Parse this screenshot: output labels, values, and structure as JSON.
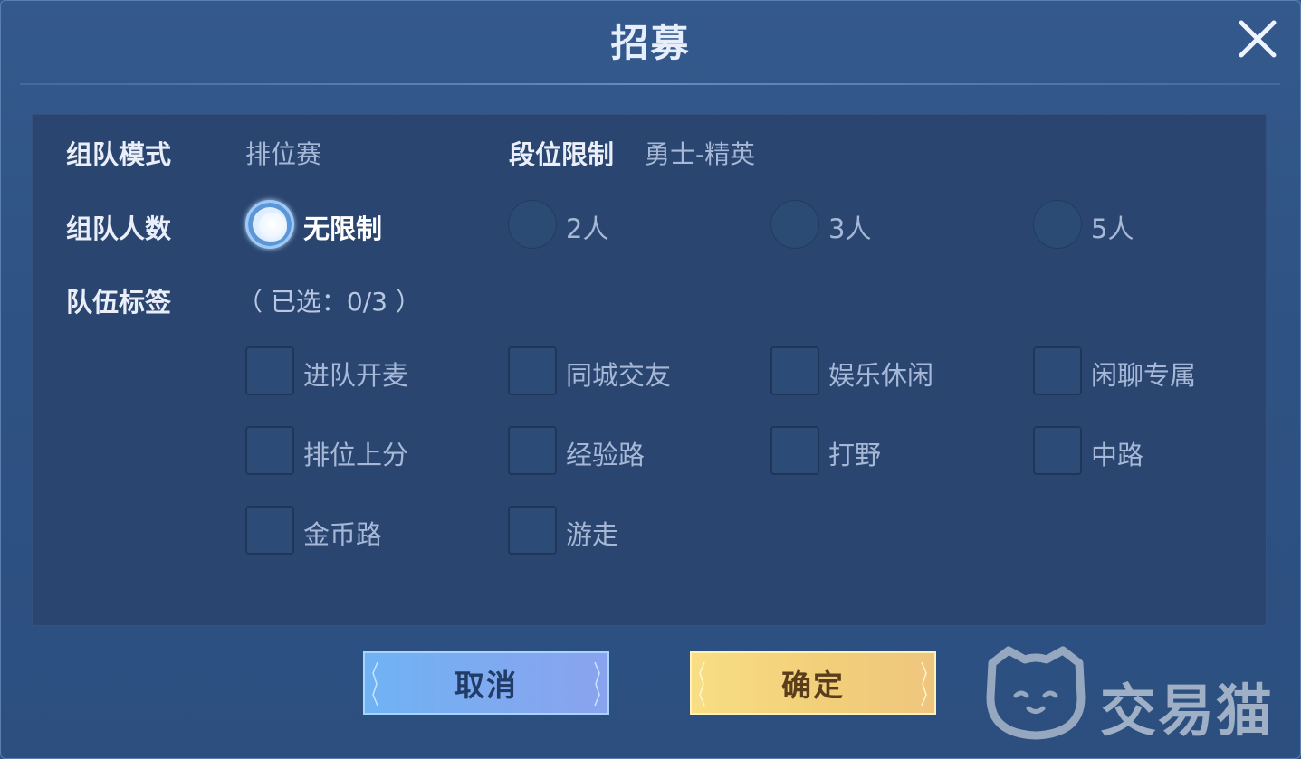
{
  "dialog": {
    "title": "招募"
  },
  "form": {
    "mode": {
      "label": "组队模式",
      "value": "排位赛"
    },
    "rank_limit": {
      "label": "段位限制",
      "value": "勇士-精英"
    },
    "team_size": {
      "label": "组队人数",
      "options": [
        {
          "label": "无限制",
          "selected": true
        },
        {
          "label": "2人",
          "selected": false
        },
        {
          "label": "3人",
          "selected": false
        },
        {
          "label": "5人",
          "selected": false
        }
      ]
    },
    "tags": {
      "label": "队伍标签",
      "selected_count_text": "（ 已选：0/3 ）",
      "items": [
        {
          "label": "进队开麦",
          "checked": false
        },
        {
          "label": "同城交友",
          "checked": false
        },
        {
          "label": "娱乐休闲",
          "checked": false
        },
        {
          "label": "闲聊专属",
          "checked": false
        },
        {
          "label": "排位上分",
          "checked": false
        },
        {
          "label": "经验路",
          "checked": false
        },
        {
          "label": "打野",
          "checked": false
        },
        {
          "label": "中路",
          "checked": false
        },
        {
          "label": "金币路",
          "checked": false
        },
        {
          "label": "游走",
          "checked": false
        }
      ]
    }
  },
  "buttons": {
    "cancel": "取消",
    "confirm": "确定"
  },
  "watermark": {
    "text": "交易猫"
  },
  "colors": {
    "background": "#2e5283",
    "panel": "#2a4670",
    "cancel_button": "#7fa9f0",
    "confirm_button": "#f2cf7a"
  }
}
